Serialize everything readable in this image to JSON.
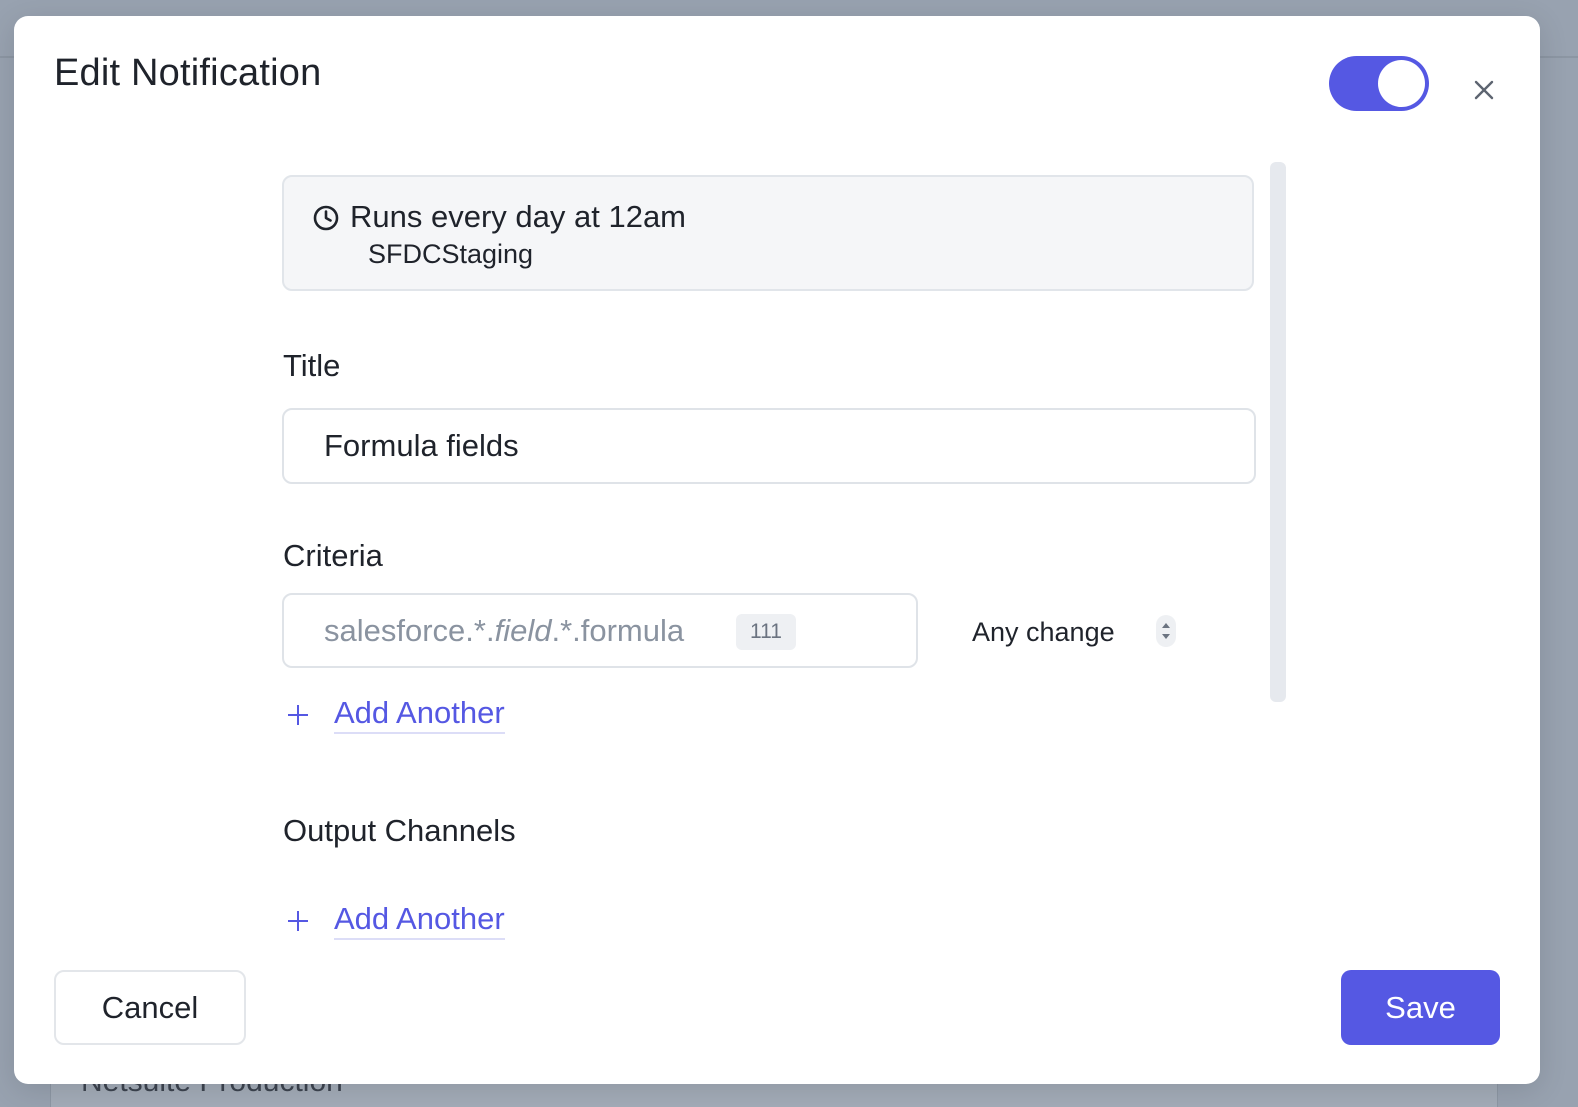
{
  "background": {
    "card_label": "Netsuite Production"
  },
  "modal": {
    "title": "Edit Notification",
    "enabled": true,
    "accent_color": "#5558e3",
    "schedule": {
      "icon": "clock-icon",
      "text": "Runs every day at 12am",
      "source": "SFDCStaging"
    },
    "title_field": {
      "label": "Title",
      "value": "Formula fields"
    },
    "criteria": {
      "label": "Criteria",
      "rules": [
        {
          "parts": [
            "salesforce.*.",
            "field",
            ".*.formula"
          ],
          "count": "111",
          "condition": "Any change"
        }
      ],
      "add_label": "Add Another"
    },
    "output_channels": {
      "label": "Output Channels",
      "add_label": "Add Another"
    },
    "footer": {
      "cancel_label": "Cancel",
      "save_label": "Save"
    }
  }
}
